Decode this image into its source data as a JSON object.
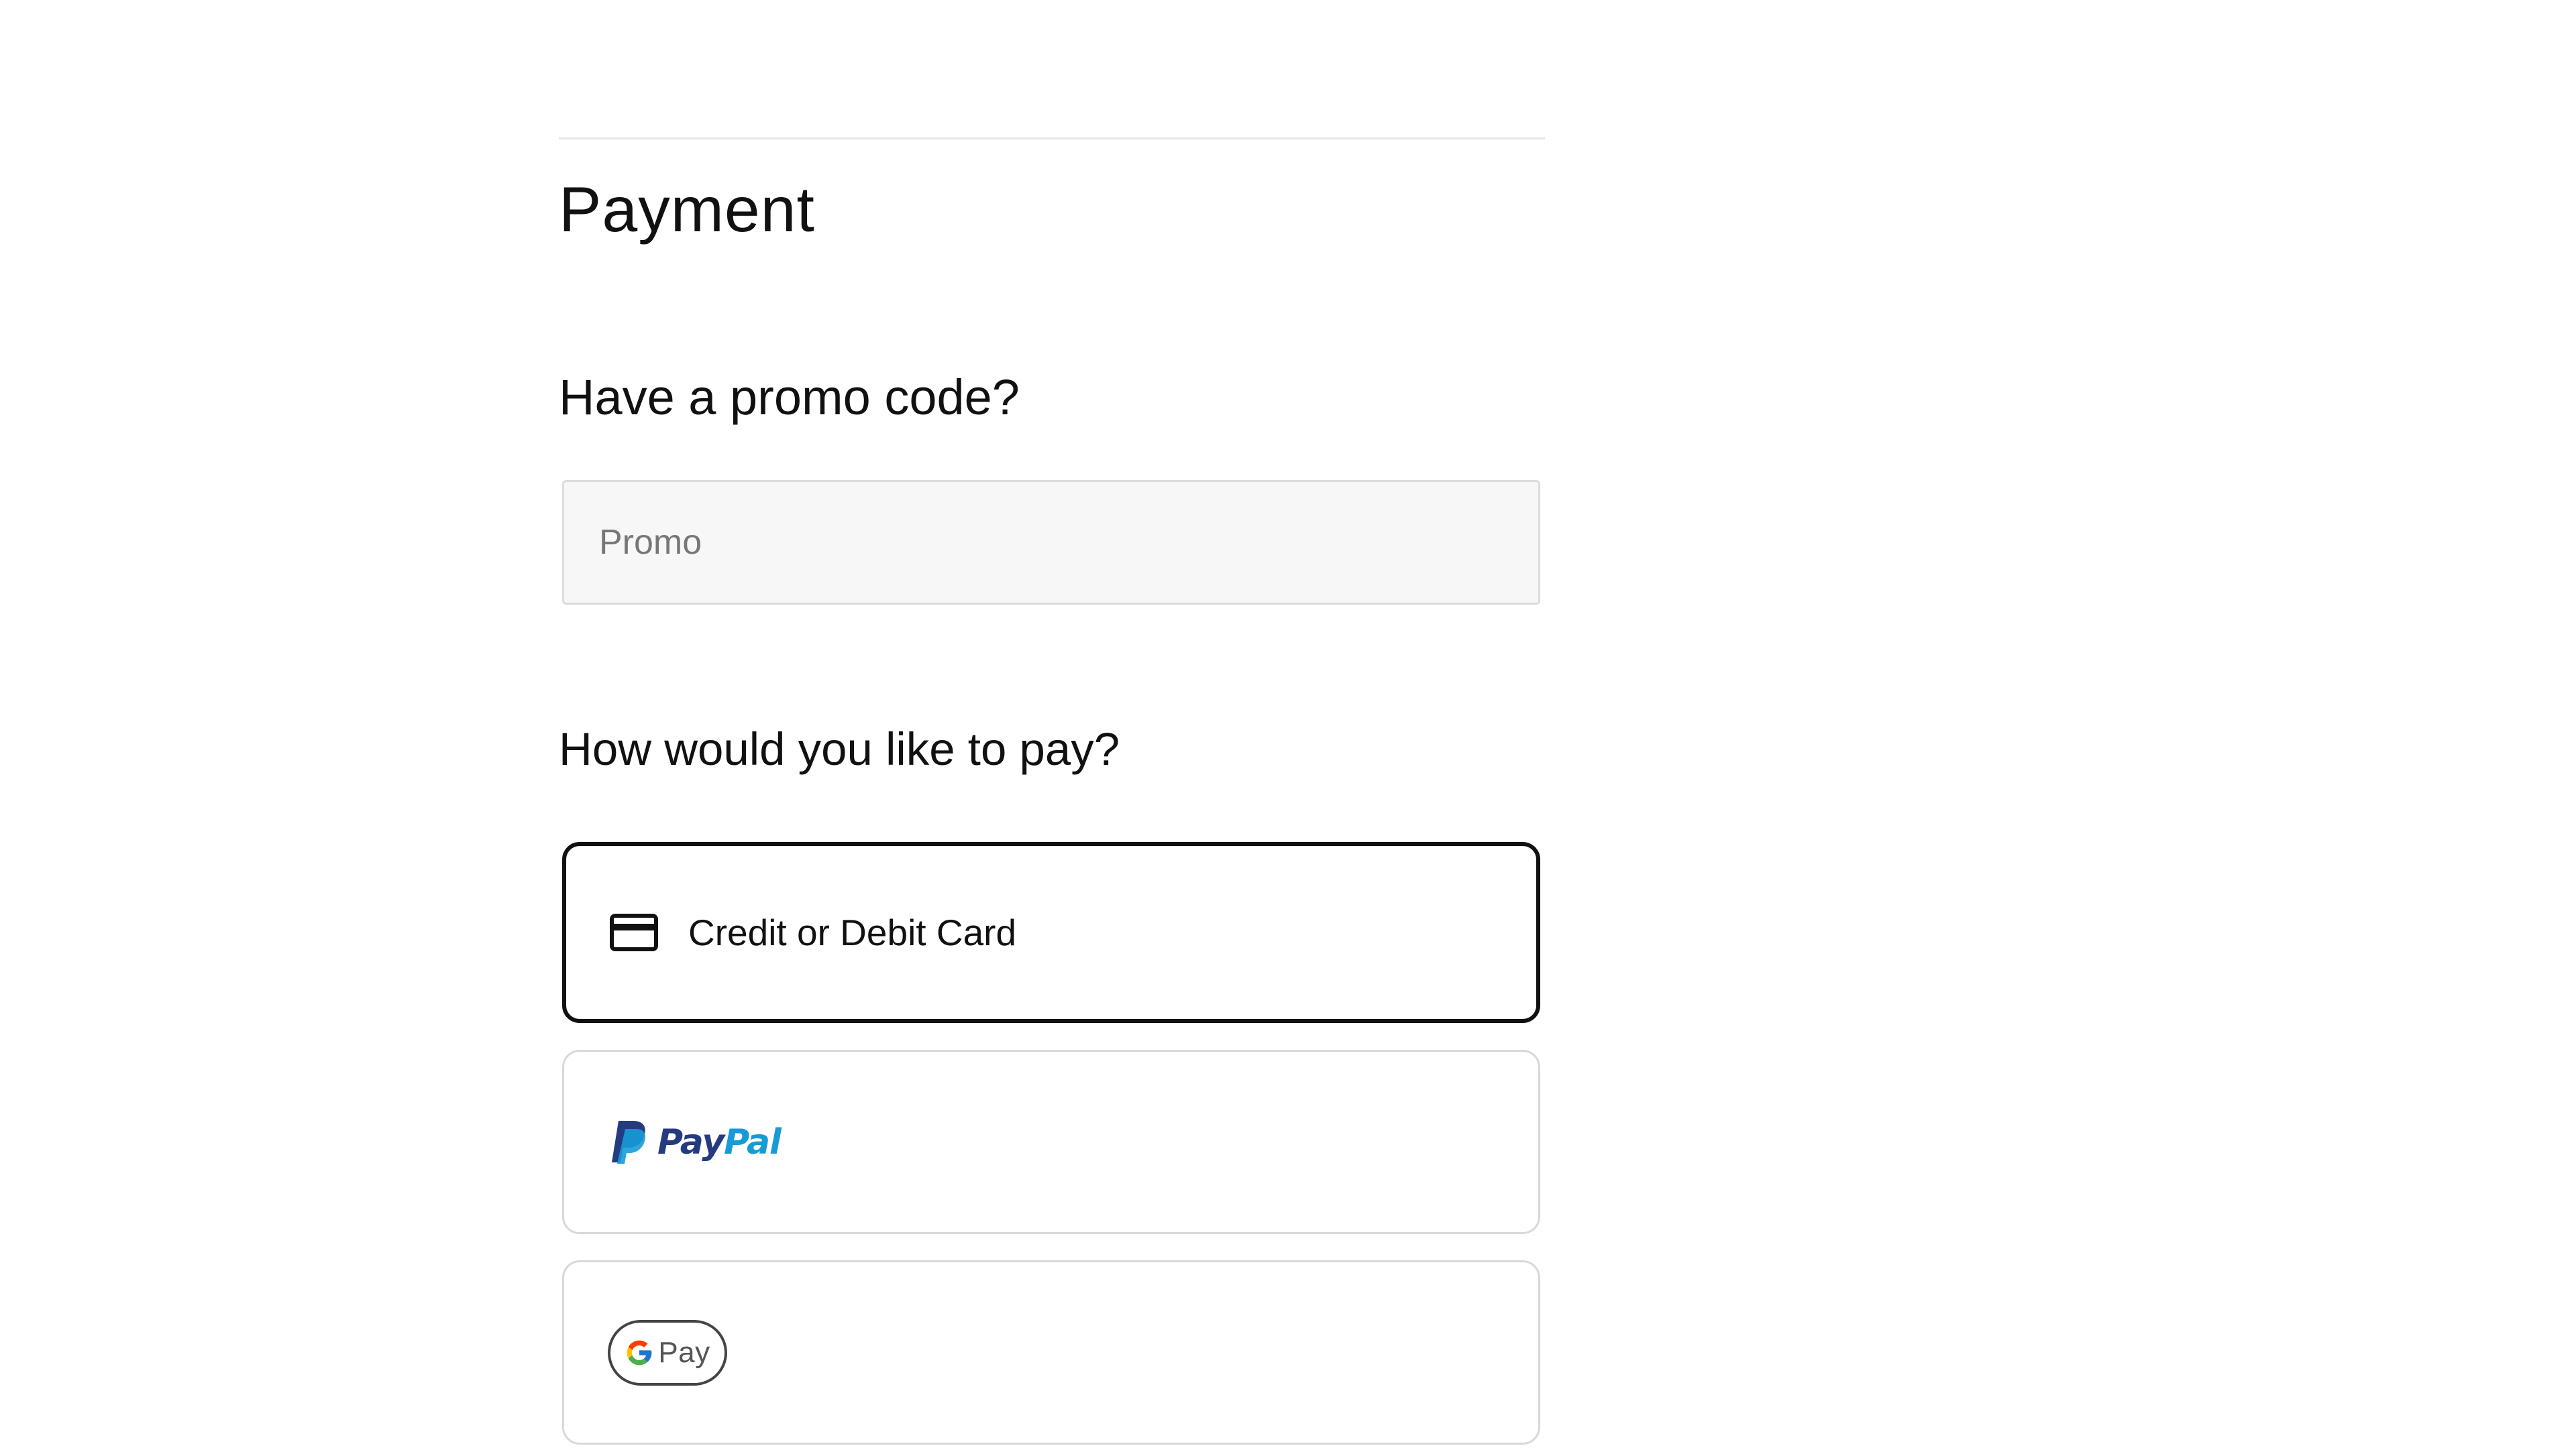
{
  "payment": {
    "title": "Payment",
    "promo": {
      "heading": "Have a promo code?",
      "placeholder": "Promo",
      "value": ""
    },
    "methods_heading": "How would you like to pay?",
    "methods": [
      {
        "label": "Credit or Debit Card",
        "icon": "credit-card-icon",
        "selected": true
      },
      {
        "label_part1": "Pay",
        "label_part2": "Pal",
        "icon": "paypal-logo"
      },
      {
        "label": "Pay",
        "icon": "google-pay-logo"
      }
    ]
  },
  "colors": {
    "selected_border": "#111111",
    "unselected_border": "#d8d8d8",
    "input_background": "#f7f7f7",
    "paypal_dark": "#253b80",
    "paypal_light": "#179bd7"
  }
}
